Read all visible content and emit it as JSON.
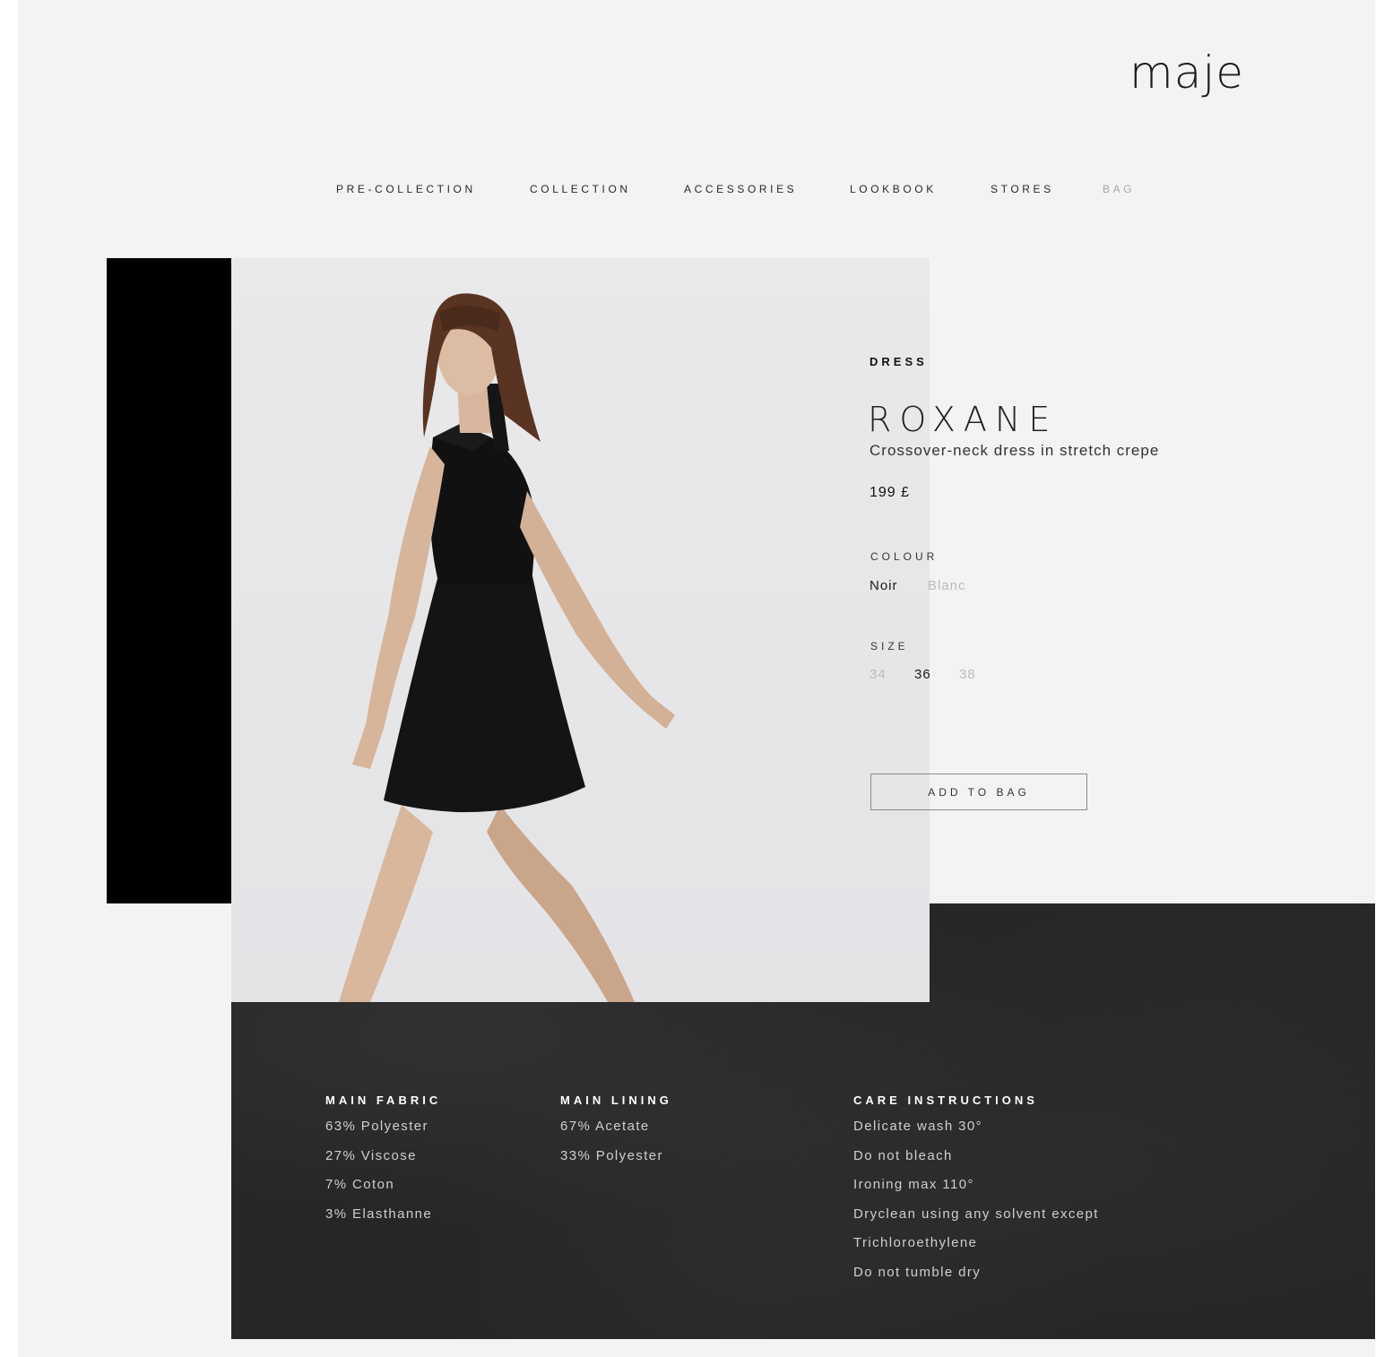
{
  "brand": {
    "logo": "maje"
  },
  "nav": [
    {
      "label": "PRE-COLLECTION",
      "active": true
    },
    {
      "label": "COLLECTION",
      "active": true
    },
    {
      "label": "ACCESSORIES",
      "active": true
    },
    {
      "label": "LOOKBOOK",
      "active": true
    },
    {
      "label": "STORES",
      "active": true
    },
    {
      "label": "BAG",
      "active": false
    }
  ],
  "product": {
    "category": "DRESS",
    "name": "ROXANE",
    "description": "Crossover-neck dress in stretch crepe",
    "price": "199 £",
    "colour_label": "COLOUR",
    "colours": [
      {
        "name": "Noir",
        "selected": true
      },
      {
        "name": "Blanc",
        "selected": false
      }
    ],
    "size_label": "SIZE",
    "sizes": [
      {
        "name": "34",
        "selected": false
      },
      {
        "name": "36",
        "selected": true
      },
      {
        "name": "38",
        "selected": false
      }
    ],
    "add_to_bag": "ADD TO BAG"
  },
  "details": {
    "main_fabric": {
      "title": "MAIN FABRIC",
      "lines": [
        "63% Polyester",
        "27% Viscose",
        "7% Coton",
        "3% Elasthanne"
      ]
    },
    "main_lining": {
      "title": "MAIN LINING",
      "lines": [
        "67% Acetate",
        "33% Polyester"
      ]
    },
    "care": {
      "title": "CARE INSTRUCTIONS",
      "lines": [
        "Delicate wash 30°",
        "Do not bleach",
        "Ironing max 110°",
        "Dryclean using any solvent except",
        "Trichloroethylene",
        "Do not tumble dry"
      ]
    }
  },
  "colors": {
    "page_bg": "#f3f3f3",
    "dark_panel": "#262626",
    "accent_black": "#000000",
    "muted_text": "#bbbbbb"
  }
}
